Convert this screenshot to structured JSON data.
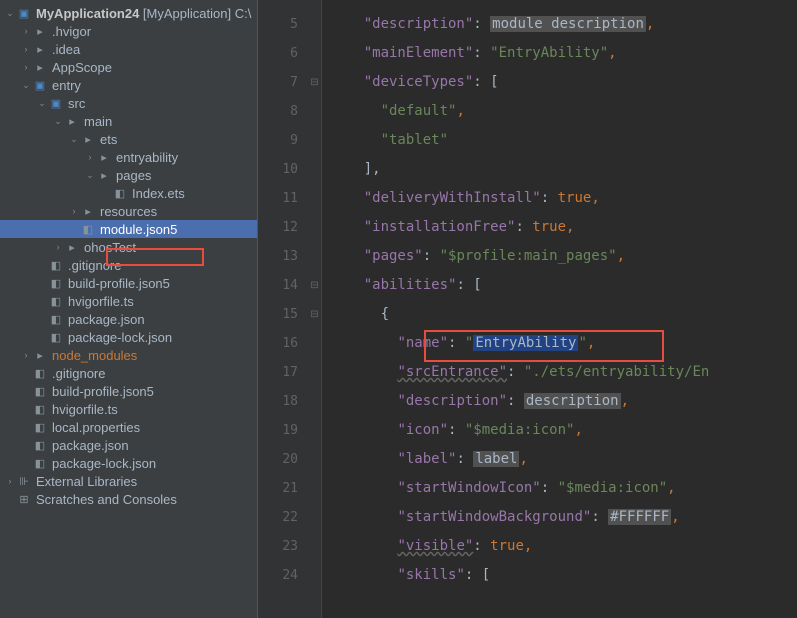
{
  "tree": {
    "root": "MyApplication24",
    "root_bracket": "[MyApplication]",
    "root_suffix": " C:\\",
    "items": [
      {
        "label": ".hvigor",
        "pad": 1,
        "chev": ">",
        "icon": "folder"
      },
      {
        "label": ".idea",
        "pad": 1,
        "chev": ">",
        "icon": "folder"
      },
      {
        "label": "AppScope",
        "pad": 1,
        "chev": ">",
        "icon": "folder"
      },
      {
        "label": "entry",
        "pad": 1,
        "chev": "v",
        "icon": "folder-blue"
      },
      {
        "label": "src",
        "pad": 2,
        "chev": "v",
        "icon": "folder-blue"
      },
      {
        "label": "main",
        "pad": 3,
        "chev": "v",
        "icon": "folder"
      },
      {
        "label": "ets",
        "pad": 4,
        "chev": "v",
        "icon": "folder"
      },
      {
        "label": "entryability",
        "pad": 5,
        "chev": ">",
        "icon": "folder"
      },
      {
        "label": "pages",
        "pad": 5,
        "chev": "v",
        "icon": "folder"
      },
      {
        "label": "Index.ets",
        "pad": 6,
        "chev": " ",
        "icon": "file"
      },
      {
        "label": "resources",
        "pad": 4,
        "chev": ">",
        "icon": "folder"
      },
      {
        "label": "module.json5",
        "pad": 4,
        "chev": " ",
        "icon": "file",
        "selected": true
      },
      {
        "label": "ohosTest",
        "pad": 3,
        "chev": ">",
        "icon": "folder"
      },
      {
        "label": ".gitignore",
        "pad": 2,
        "chev": " ",
        "icon": "file"
      },
      {
        "label": "build-profile.json5",
        "pad": 2,
        "chev": " ",
        "icon": "file"
      },
      {
        "label": "hvigorfile.ts",
        "pad": 2,
        "chev": " ",
        "icon": "file"
      },
      {
        "label": "package.json",
        "pad": 2,
        "chev": " ",
        "icon": "file"
      },
      {
        "label": "package-lock.json",
        "pad": 2,
        "chev": " ",
        "icon": "file"
      },
      {
        "label": "node_modules",
        "pad": 1,
        "chev": ">",
        "icon": "folder",
        "orange": true
      },
      {
        "label": ".gitignore",
        "pad": 1,
        "chev": " ",
        "icon": "file"
      },
      {
        "label": "build-profile.json5",
        "pad": 1,
        "chev": " ",
        "icon": "file"
      },
      {
        "label": "hvigorfile.ts",
        "pad": 1,
        "chev": " ",
        "icon": "file"
      },
      {
        "label": "local.properties",
        "pad": 1,
        "chev": " ",
        "icon": "file"
      },
      {
        "label": "package.json",
        "pad": 1,
        "chev": " ",
        "icon": "file"
      },
      {
        "label": "package-lock.json",
        "pad": 1,
        "chev": " ",
        "icon": "file"
      },
      {
        "label": "External Libraries",
        "pad": 0,
        "chev": ">",
        "icon": "lib"
      },
      {
        "label": "Scratches and Consoles",
        "pad": 0,
        "chev": " ",
        "icon": "scratch"
      }
    ]
  },
  "editor": {
    "lines": [
      5,
      6,
      7,
      8,
      9,
      10,
      11,
      12,
      13,
      14,
      15,
      16,
      17,
      18,
      19,
      20,
      21,
      22,
      23,
      24
    ],
    "code": {
      "l5": {
        "key": "\"description\"",
        "val": "module description"
      },
      "l6": {
        "key": "\"mainElement\"",
        "val": "\"EntryAbility\""
      },
      "l7": {
        "key": "\"deviceTypes\"",
        "bracket": "["
      },
      "l8": {
        "val": "\"default\""
      },
      "l9": {
        "val": "\"tablet\""
      },
      "l10": {
        "bracket": "],"
      },
      "l11": {
        "key": "\"deliveryWithInstall\"",
        "val": "true"
      },
      "l12": {
        "key": "\"installationFree\"",
        "val": "true"
      },
      "l13": {
        "key": "\"pages\"",
        "val": "\"$profile:main_pages\""
      },
      "l14": {
        "key": "\"abilities\"",
        "bracket": "["
      },
      "l15": {
        "bracket": "{"
      },
      "l16": {
        "key": "\"name\"",
        "val": "\"EntryAbility\""
      },
      "l17": {
        "key": "\"srcEntrance\"",
        "val": "\"./ets/entryability/En"
      },
      "l18": {
        "key": "\"description\"",
        "val": "description"
      },
      "l19": {
        "key": "\"icon\"",
        "val": "\"$media:icon\""
      },
      "l20": {
        "key": "\"label\"",
        "val": "label"
      },
      "l21": {
        "key": "\"startWindowIcon\"",
        "val": "\"$media:icon\""
      },
      "l22": {
        "key": "\"startWindowBackground\"",
        "val": "#FFFFFF"
      },
      "l23": {
        "key": "\"visible\"",
        "val": "true"
      },
      "l24": {
        "key": "\"skills\"",
        "bracket": "["
      }
    }
  }
}
